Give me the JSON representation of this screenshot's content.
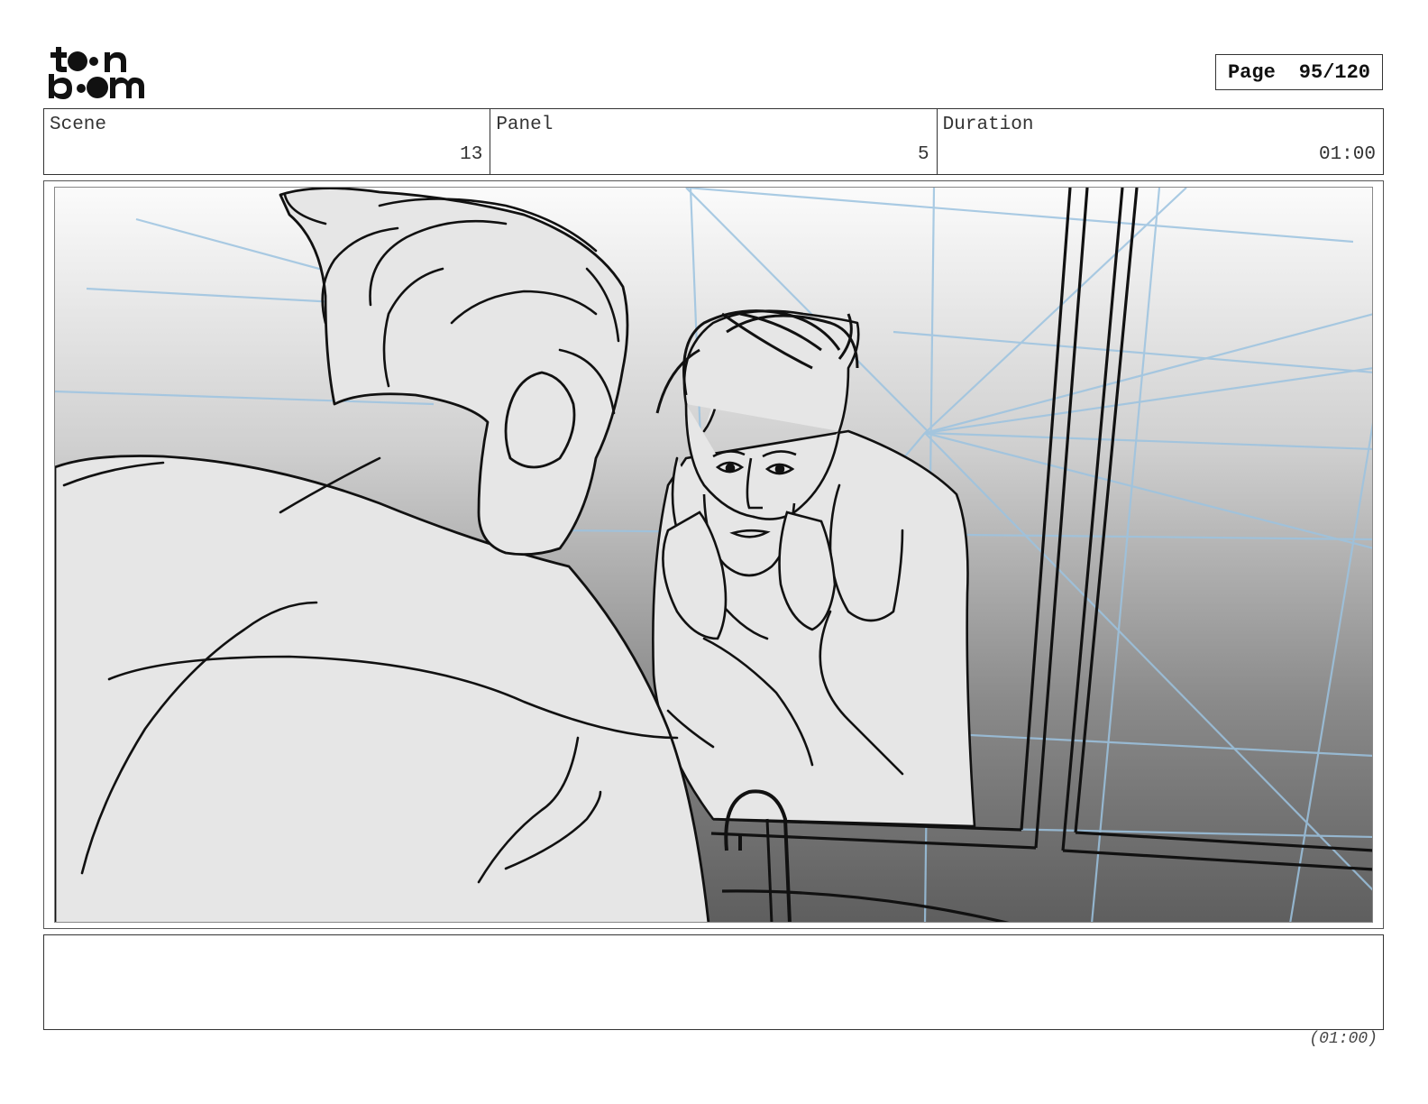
{
  "header": {
    "logo_text": "toon boom",
    "page_label": "Page",
    "page_number": "95/120"
  },
  "info": {
    "scene_label": "Scene",
    "scene_value": "13",
    "panel_label": "Panel",
    "panel_value": "5",
    "duration_label": "Duration",
    "duration_value": "01:00"
  },
  "notes": {
    "text": ""
  },
  "footer": {
    "duration": "(01:00)"
  }
}
